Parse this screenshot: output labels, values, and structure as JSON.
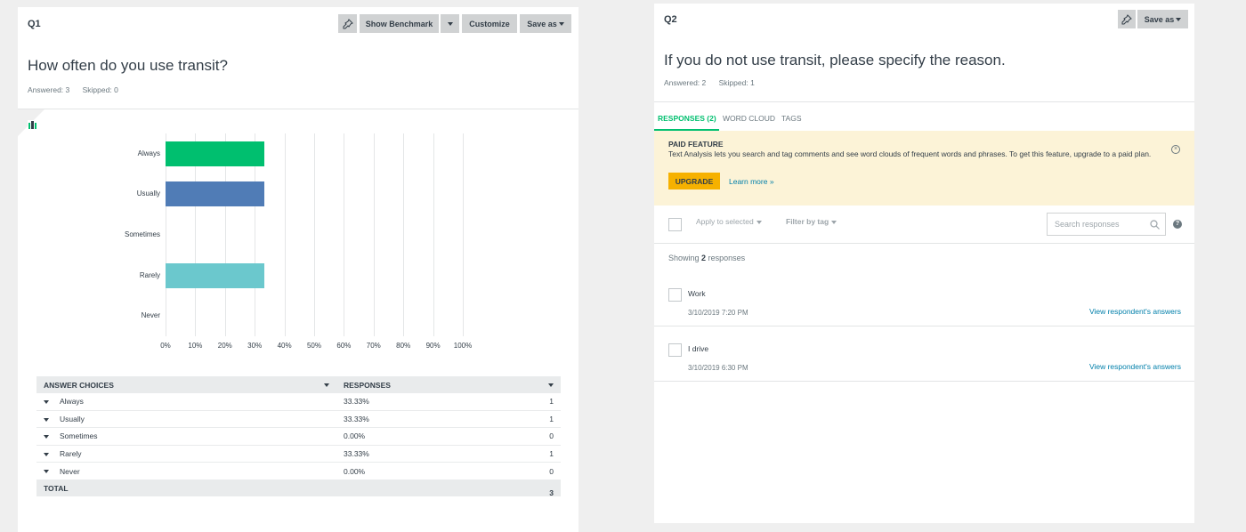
{
  "colors": {
    "bar_always": "#00bf6f",
    "bar_usually": "#507cb6",
    "bar_rarely": "#6bc8cd",
    "accent_green": "#00bf6f",
    "upgrade_yellow": "#f6b100",
    "link_blue": "#007faa"
  },
  "q1": {
    "number": "Q1",
    "pin_icon": "pin-icon",
    "show_benchmark_label": "Show Benchmark",
    "customize_label": "Customize",
    "save_as_label": "Save as",
    "title": "How often do you use transit?",
    "answered": "Answered: 3",
    "skipped": "Skipped: 0",
    "chart_type_icon": "chart-type-icon",
    "table": {
      "header_choices": "ANSWER CHOICES",
      "header_responses": "RESPONSES",
      "rows": [
        {
          "choice": "Always",
          "percent": "33.33%",
          "count": "1"
        },
        {
          "choice": "Usually",
          "percent": "33.33%",
          "count": "1"
        },
        {
          "choice": "Sometimes",
          "percent": "0.00%",
          "count": "0"
        },
        {
          "choice": "Rarely",
          "percent": "33.33%",
          "count": "1"
        },
        {
          "choice": "Never",
          "percent": "0.00%",
          "count": "0"
        }
      ],
      "total_label": "TOTAL",
      "total_count": "3"
    }
  },
  "chart_data": {
    "type": "bar",
    "orientation": "horizontal",
    "categories": [
      "Always",
      "Usually",
      "Sometimes",
      "Rarely",
      "Never"
    ],
    "values": [
      33.33,
      33.33,
      0,
      33.33,
      0
    ],
    "xticks": [
      "0%",
      "10%",
      "20%",
      "30%",
      "40%",
      "50%",
      "60%",
      "70%",
      "80%",
      "90%",
      "100%"
    ],
    "xlim": [
      0,
      100
    ],
    "grid": true
  },
  "q2": {
    "number": "Q2",
    "pin_icon": "pin-icon",
    "save_as_label": "Save as",
    "title": "If you do not use transit, please specify the reason.",
    "answered": "Answered: 2",
    "skipped": "Skipped: 1",
    "tabs": [
      {
        "label": "RESPONSES (2)",
        "active": true
      },
      {
        "label": "WORD CLOUD",
        "active": false
      },
      {
        "label": "TAGS",
        "active": false
      }
    ],
    "banner": {
      "title": "PAID FEATURE",
      "text": "Text Analysis lets you search and tag comments and see word clouds of frequent words and phrases. To get this feature, upgrade to a paid plan.",
      "upgrade_label": "UPGRADE",
      "learn_more": "Learn more »",
      "close_glyph": "×"
    },
    "apply_to_selected": "Apply to selected",
    "filter_by_tag": "Filter by tag",
    "search_placeholder": "Search responses",
    "help_glyph": "?",
    "showing_prefix": "Showing",
    "showing_count": "2",
    "showing_suffix": "responses",
    "responses": [
      {
        "text": "Work",
        "date": "3/10/2019 7:20 PM",
        "link": "View respondent's answers"
      },
      {
        "text": "I drive",
        "date": "3/10/2019 6:30 PM",
        "link": "View respondent's answers"
      }
    ]
  }
}
